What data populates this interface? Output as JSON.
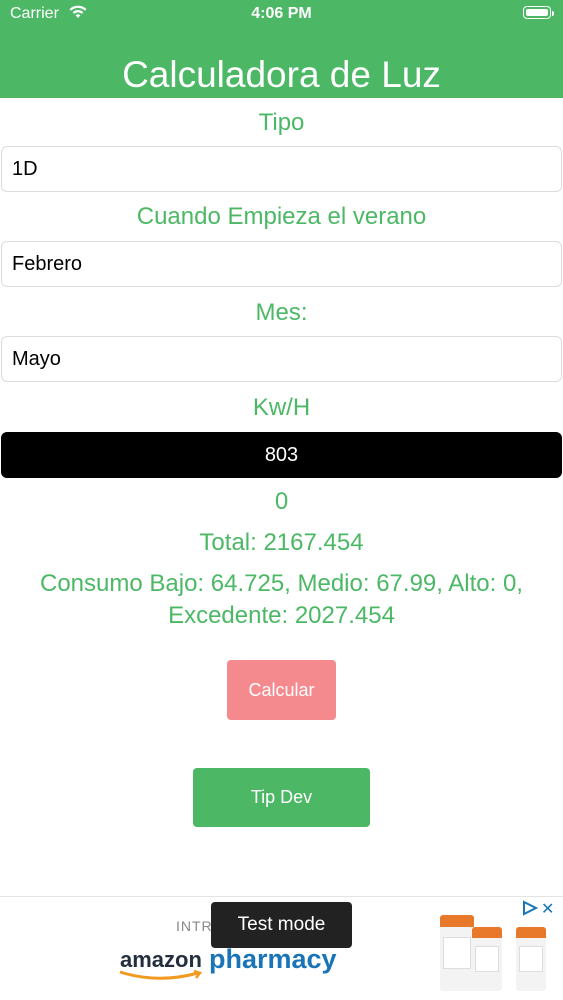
{
  "status_bar": {
    "carrier": "Carrier",
    "time": "4:06 PM",
    "wifi_icon": "wifi-icon",
    "battery_icon": "battery-icon"
  },
  "header": {
    "title": "Calculadora de Luz"
  },
  "form": {
    "tipo": {
      "label": "Tipo",
      "value": "1D"
    },
    "verano": {
      "label": "Cuando Empieza el verano",
      "value": "Febrero"
    },
    "mes": {
      "label": "Mes:",
      "value": "Mayo"
    },
    "kwh": {
      "label": "Kw/H",
      "value": "803"
    }
  },
  "results": {
    "zero": "0",
    "total": "Total: 2167.454",
    "consumo_line1": "Consumo Bajo: 64.725, Medio: 67.99, Alto: 0,",
    "consumo_line2": "Excedente: 2027.454"
  },
  "buttons": {
    "calcular": "Calcular",
    "tip_dev": "Tip Dev"
  },
  "ad": {
    "intro_text": "INTR",
    "test_mode": "Test mode",
    "brand": "amazon",
    "product": "pharmacy",
    "adchoices_icon": "adchoices-icon",
    "close_icon": "close-icon"
  },
  "colors": {
    "header_green": "#4cb865",
    "label_green": "#4cb865",
    "calc_button": "#f58a8e",
    "kwh_field": "#000000"
  }
}
